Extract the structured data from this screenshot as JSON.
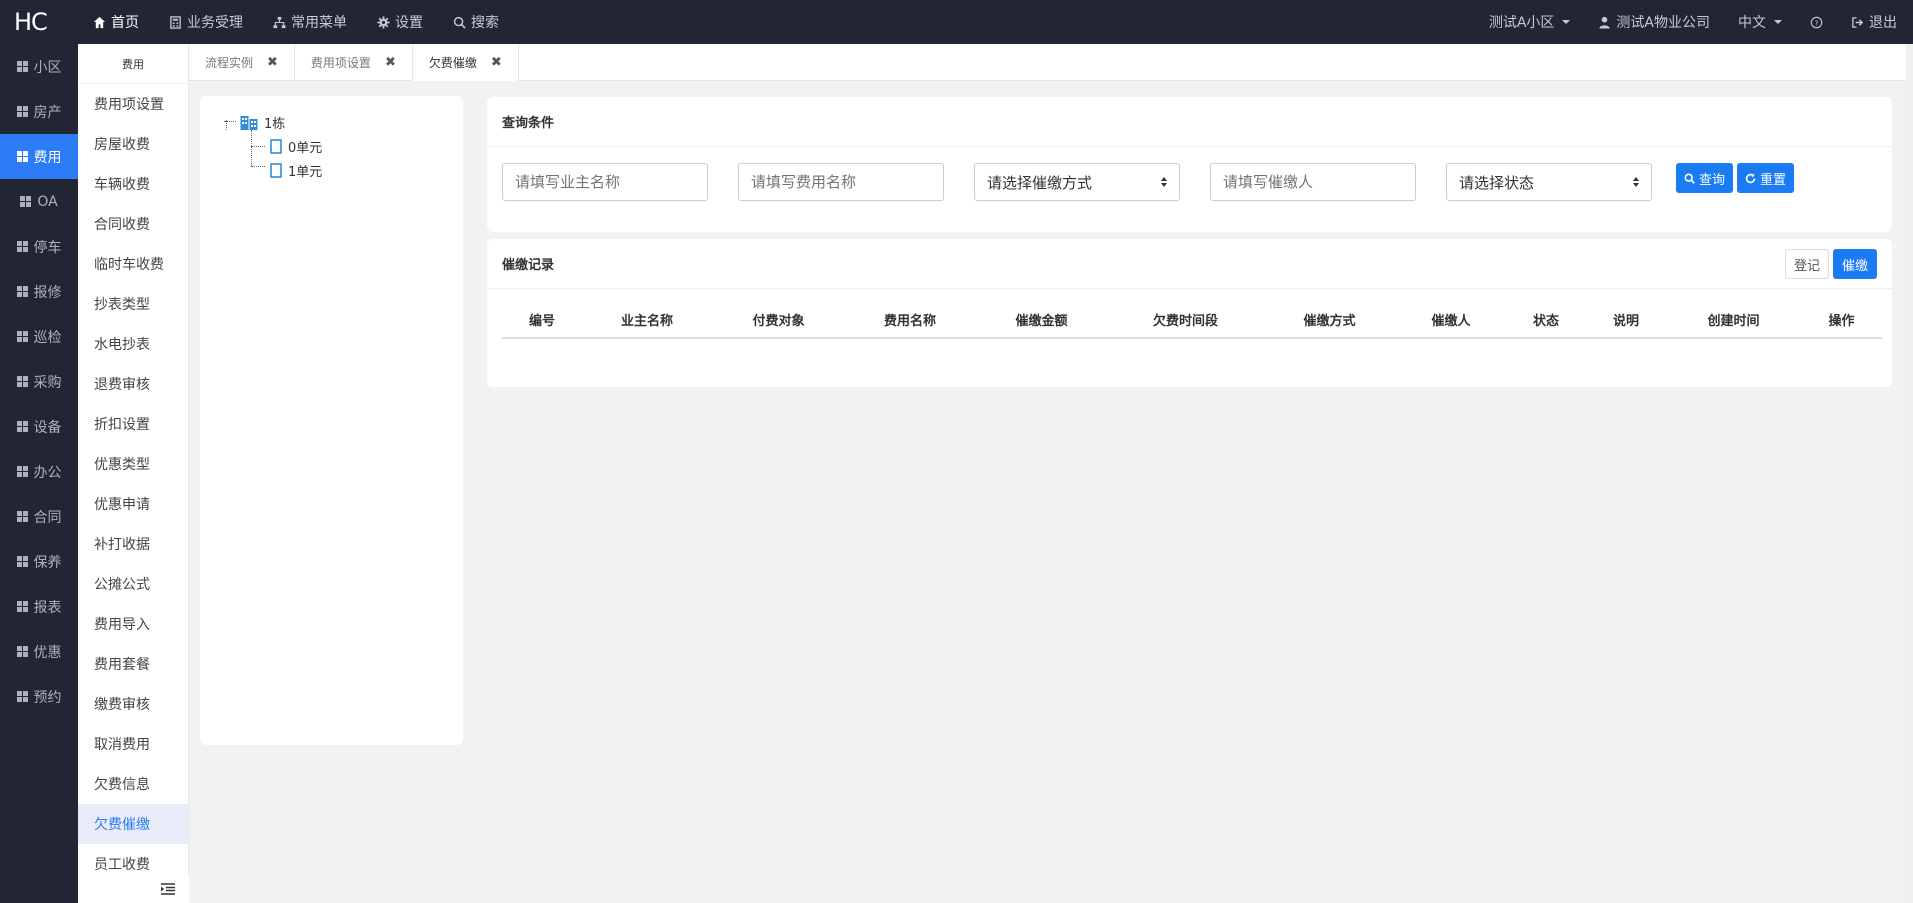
{
  "logo": "HC",
  "topnav": [
    {
      "label": "首页",
      "icon": "home-icon"
    },
    {
      "label": "业务受理",
      "icon": "calculator-icon"
    },
    {
      "label": "常用菜单",
      "icon": "sitemap-icon"
    },
    {
      "label": "设置",
      "icon": "gear-icon"
    },
    {
      "label": "搜索",
      "icon": "search-icon"
    }
  ],
  "topright": {
    "community": "测试A小区",
    "company": "测试A物业公司",
    "language": "中文",
    "help": "?",
    "logout": "退出"
  },
  "sidebar1": [
    "小区",
    "房产",
    "费用",
    "OA",
    "停车",
    "报修",
    "巡检",
    "采购",
    "设备",
    "办公",
    "合同",
    "保养",
    "报表",
    "优惠",
    "预约"
  ],
  "sidebar1_active": "费用",
  "sidebar2": {
    "header": "费用",
    "items": [
      "费用项设置",
      "房屋收费",
      "车辆收费",
      "合同收费",
      "临时车收费",
      "抄表类型",
      "水电抄表",
      "退费审核",
      "折扣设置",
      "优惠类型",
      "优惠申请",
      "补打收据",
      "公摊公式",
      "费用导入",
      "费用套餐",
      "缴费审核",
      "取消费用",
      "欠费信息",
      "欠费催缴",
      "员工收费"
    ],
    "active": "欠费催缴"
  },
  "tabs": [
    {
      "label": "流程实例",
      "close": "✖"
    },
    {
      "label": "费用项设置",
      "close": "✖"
    },
    {
      "label": "欠费催缴",
      "close": "✖"
    }
  ],
  "tree": {
    "root": "1栋",
    "children": [
      "0单元",
      "1单元"
    ]
  },
  "query": {
    "title": "查询条件",
    "owner_placeholder": "请填写业主名称",
    "fee_placeholder": "请填写费用名称",
    "method_select": "请选择催缴方式",
    "collector_placeholder": "请填写催缴人",
    "status_select": "请选择状态",
    "search_label": "查询",
    "reset_label": "重置"
  },
  "records": {
    "title": "催缴记录",
    "register_label": "登记",
    "collect_label": "催缴",
    "columns": [
      "编号",
      "业主名称",
      "付费对象",
      "费用名称",
      "催缴金额",
      "欠费时间段",
      "催缴方式",
      "催缴人",
      "状态",
      "说明",
      "创建时间",
      "操作"
    ]
  },
  "colors": {
    "nav_bg": "#222533",
    "accent": "#1a7bf2"
  }
}
